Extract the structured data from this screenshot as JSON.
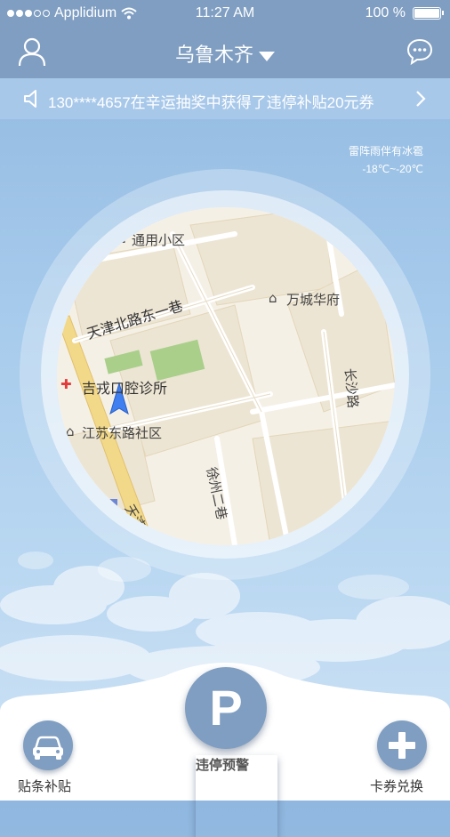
{
  "status_bar": {
    "carrier": "Applidium",
    "time": "11:27 AM",
    "battery": "100 %"
  },
  "nav": {
    "city": "乌鲁木齐",
    "left_icon": "user-icon",
    "right_icon": "chat-bubble-icon"
  },
  "notice": {
    "text": "130****4657在辛运抽奖中获得了违停补贴20元券",
    "icon": "speaker-icon"
  },
  "weather": {
    "condition": "雷阵雨伴有冰雹",
    "temperature": "-18℃~-20℃"
  },
  "map": {
    "labels": {
      "tongyong": "通用小区",
      "wancheng": "万城华府",
      "tianjin_beilu": "天津北路东一巷",
      "jirong": "吉戎口腔诊所",
      "jiangsu": "江苏东路社区",
      "xuzhou": "徐州二巷",
      "changsha": "长沙路",
      "tianjin": "天津"
    }
  },
  "bottom": {
    "left_label": "贴条补贴",
    "center_label": "违停预警",
    "center_symbol": "P",
    "right_label": "卡券兑换"
  },
  "colors": {
    "nav_bg": "#7f9ec2",
    "notice_bg": "#a8c8ea",
    "button": "#7f9ec2"
  }
}
